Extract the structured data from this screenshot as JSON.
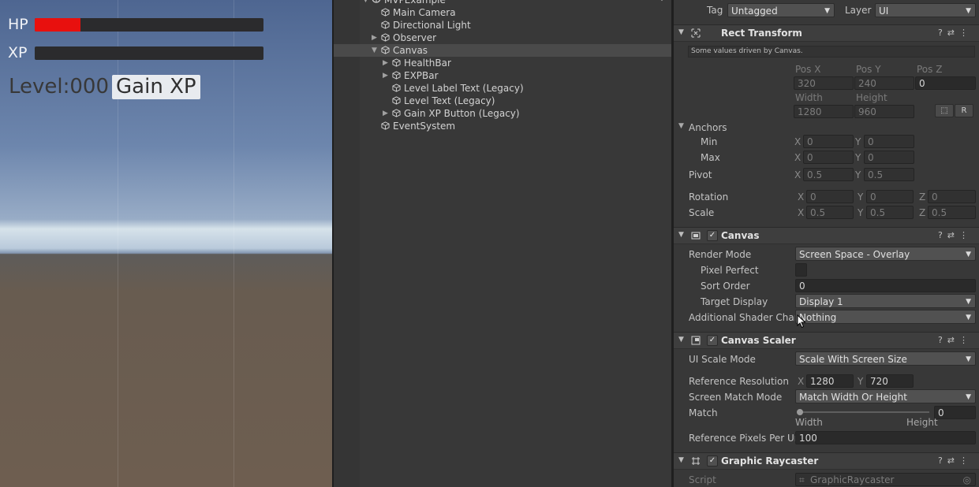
{
  "game": {
    "hp_label": "HP",
    "xp_label": "XP",
    "hp_value": 0.2,
    "xp_value": 0.0,
    "hp_color": "#e8100e",
    "level_text": "Level:000",
    "gain_xp_button": "Gain XP"
  },
  "hierarchy": {
    "scene": "MVPExample",
    "items": [
      {
        "label": "Main Camera"
      },
      {
        "label": "Directional Light"
      },
      {
        "label": "Observer"
      },
      {
        "label": "Canvas"
      },
      {
        "label": "HealthBar"
      },
      {
        "label": "EXPBar"
      },
      {
        "label": "Level Label Text (Legacy)"
      },
      {
        "label": "Level Text (Legacy)"
      },
      {
        "label": "Gain XP Button (Legacy)"
      },
      {
        "label": "EventSystem"
      }
    ]
  },
  "inspector": {
    "tag_label": "Tag",
    "tag_value": "Untagged",
    "layer_label": "Layer",
    "layer_value": "UI",
    "rect_transform": {
      "title": "Rect Transform",
      "note": "Some values driven by Canvas.",
      "pos_x_label": "Pos X",
      "pos_y_label": "Pos Y",
      "pos_z_label": "Pos Z",
      "pos_x": "320",
      "pos_y": "240",
      "pos_z": "0",
      "width_label": "Width",
      "height_label": "Height",
      "width": "1280",
      "height": "960",
      "r_button": "R",
      "anchors_label": "Anchors",
      "min_label": "Min",
      "max_label": "Max",
      "min_x": "0",
      "min_y": "0",
      "max_x": "0",
      "max_y": "0",
      "pivot_label": "Pivot",
      "pivot_x": "0.5",
      "pivot_y": "0.5",
      "rotation_label": "Rotation",
      "rot_x": "0",
      "rot_y": "0",
      "rot_z": "0",
      "scale_label": "Scale",
      "scale_x": "0.5",
      "scale_y": "0.5",
      "scale_z": "0.5",
      "x": "X",
      "y": "Y",
      "z": "Z"
    },
    "canvas": {
      "title": "Canvas",
      "render_mode_label": "Render Mode",
      "render_mode": "Screen Space - Overlay",
      "pixel_perfect_label": "Pixel Perfect",
      "sort_order_label": "Sort Order",
      "sort_order": "0",
      "target_display_label": "Target Display",
      "target_display": "Display 1",
      "shader_label": "Additional Shader Channe",
      "shader_value": "Nothing"
    },
    "canvas_scaler": {
      "title": "Canvas Scaler",
      "ui_scale_label": "UI Scale Mode",
      "ui_scale_value": "Scale With Screen Size",
      "ref_res_label": "Reference Resolution",
      "ref_x": "1280",
      "ref_y": "720",
      "match_mode_label": "Screen Match Mode",
      "match_mode_value": "Match Width Or Height",
      "match_label": "Match",
      "match_value": "0",
      "width_hint": "Width",
      "height_hint": "Height",
      "ref_ppu_label": "Reference Pixels Per Un",
      "ref_ppu": "100"
    },
    "graphic_raycaster": {
      "title": "Graphic Raycaster",
      "script_label": "Script",
      "script_value": "GraphicRaycaster"
    }
  }
}
